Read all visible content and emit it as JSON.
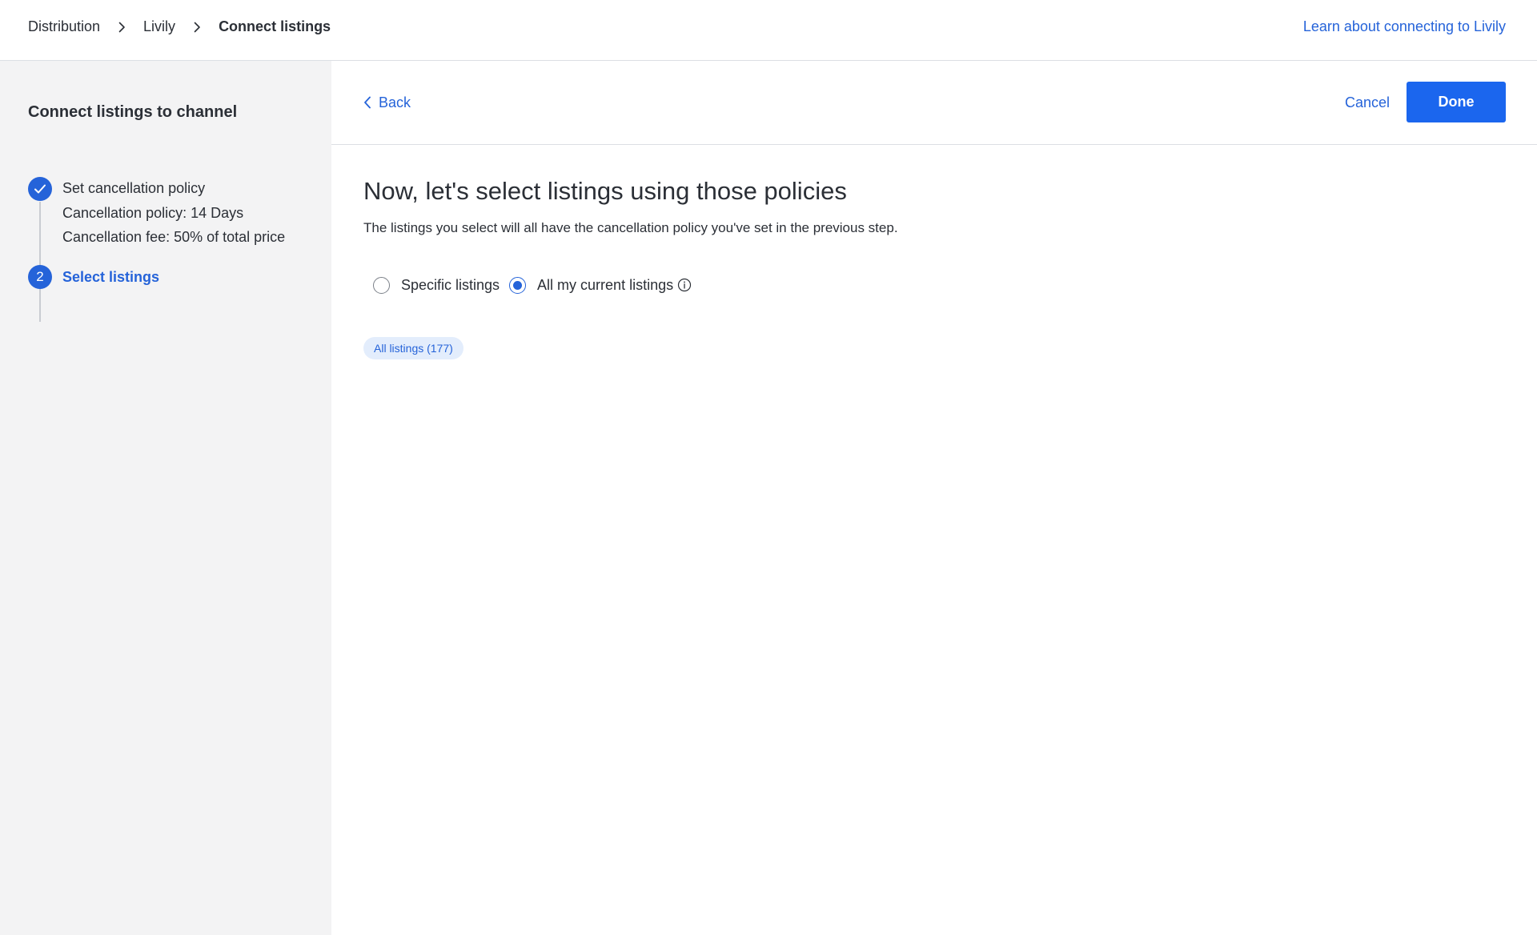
{
  "breadcrumb": {
    "items": [
      "Distribution",
      "Livily",
      "Connect listings"
    ]
  },
  "header": {
    "help_link": "Learn about connecting to Livily"
  },
  "sidebar": {
    "title": "Connect listings to channel",
    "steps": [
      {
        "number": "1",
        "icon": "check-icon",
        "label": "Set cancellation policy",
        "details": [
          "Cancellation policy: 14 Days",
          "Cancellation fee: 50% of total price"
        ]
      },
      {
        "number": "2",
        "label": "Select listings",
        "active": true
      }
    ]
  },
  "toolbar": {
    "back_label": "Back",
    "cancel_label": "Cancel",
    "done_label": "Done"
  },
  "main": {
    "title": "Now, let's select listings using those policies",
    "subtitle": "The listings you select will all have the cancellation policy you've set in the previous step.",
    "radio_options": [
      {
        "label": "Specific listings",
        "checked": false
      },
      {
        "label": "All my current listings",
        "checked": true,
        "icon": "info-icon"
      }
    ],
    "chip_label": "All listings (177)"
  },
  "colors": {
    "accent": "#2563d9",
    "primary_button": "#1b66ee",
    "sidebar_bg": "#f3f3f4",
    "chip_bg": "#e3edfc",
    "text": "#2b2f36",
    "border": "#dcdfe4"
  }
}
